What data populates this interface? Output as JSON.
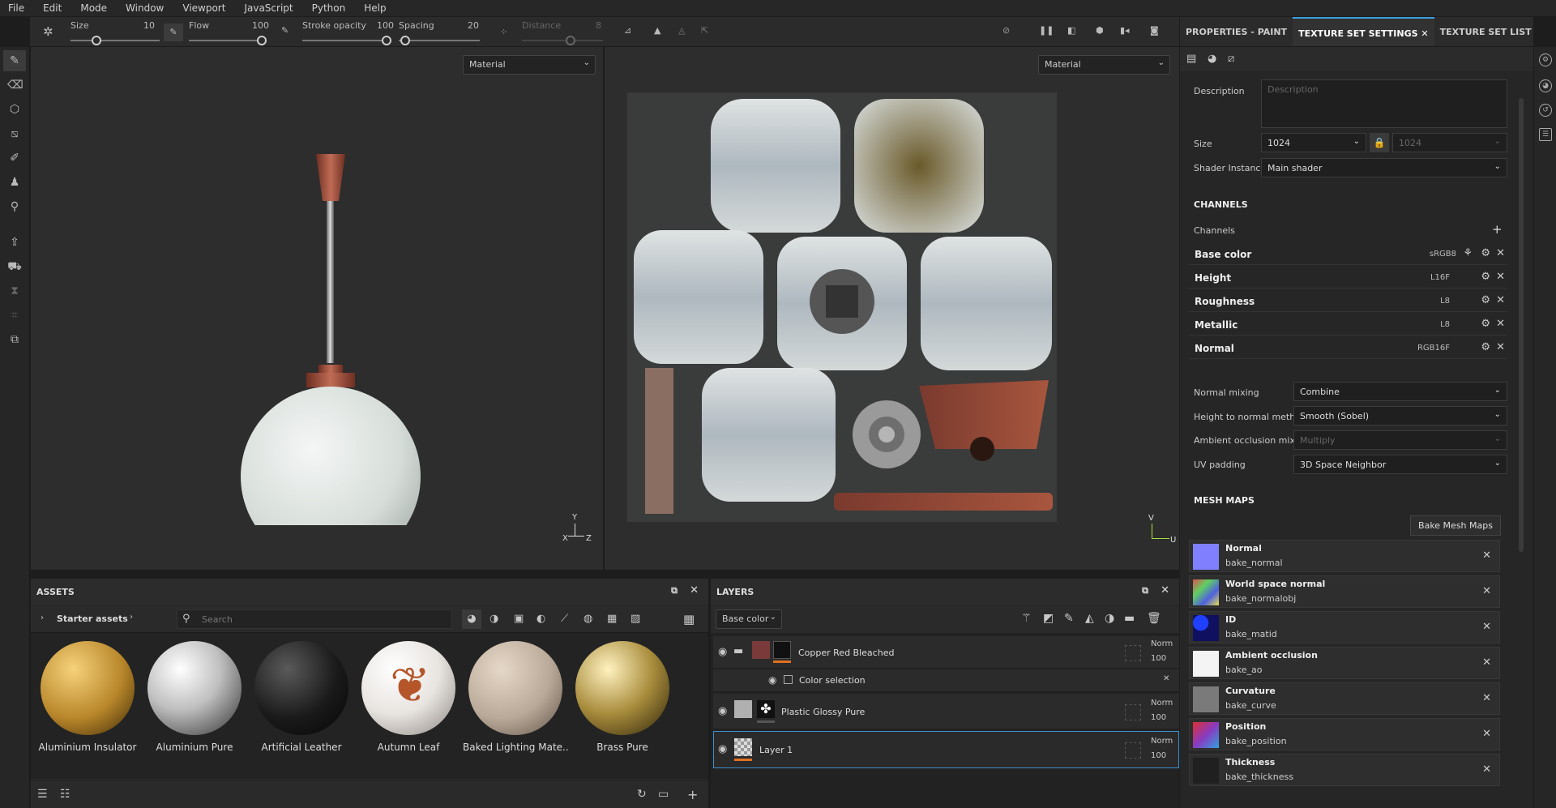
{
  "menu": [
    "File",
    "Edit",
    "Mode",
    "Window",
    "Viewport",
    "JavaScript",
    "Python",
    "Help"
  ],
  "toolbar": {
    "size_label": "Size",
    "size_value": "10",
    "flow_label": "Flow",
    "flow_value": "100",
    "stroke_label": "Stroke opacity",
    "stroke_value": "100",
    "spacing_label": "Spacing",
    "spacing_value": "20",
    "distance_label": "Distance",
    "distance_value": "8"
  },
  "viewport3d": {
    "mode": "Material",
    "axis_y": "Y",
    "axis_x": "X",
    "axis_z": "Z"
  },
  "viewport2d": {
    "mode": "Material",
    "axis_v": "V",
    "axis_u": "U"
  },
  "assets": {
    "title": "ASSETS",
    "breadcrumb": "Starter assets",
    "search_placeholder": "Search",
    "items": [
      {
        "label": "Aluminium Insulator",
        "color": "#b8862a"
      },
      {
        "label": "Aluminium Pure",
        "color": "#bfbfbf"
      },
      {
        "label": "Artificial Leather",
        "color": "#1a1a1a"
      },
      {
        "label": "Autumn Leaf",
        "color": "#e8e4e0"
      },
      {
        "label": "Baked Lighting Mate...",
        "color": "#b9a998"
      },
      {
        "label": "Brass Pure",
        "color": "#a88c3c"
      }
    ]
  },
  "layers": {
    "title": "LAYERS",
    "channel": "Base color",
    "rows": [
      {
        "name": "Copper Red Bleached",
        "blend": "Norm",
        "opacity": "100"
      },
      {
        "name": "Color selection"
      },
      {
        "name": "Plastic Glossy Pure",
        "blend": "Norm",
        "opacity": "100"
      },
      {
        "name": "Layer 1",
        "blend": "Norm",
        "opacity": "100"
      }
    ]
  },
  "rightpanel": {
    "tabs": [
      "PROPERTIES - PAINT",
      "TEXTURE SET SETTINGS",
      "TEXTURE SET LIST"
    ],
    "description_label": "Description",
    "description_placeholder": "Description",
    "size_label": "Size",
    "size_value": "1024",
    "size_value2": "1024",
    "shader_label": "Shader Instance",
    "shader_value": "Main shader",
    "channels_title": "CHANNELS",
    "channels_label": "Channels",
    "channels": [
      {
        "name": "Base color",
        "format": "sRGB8"
      },
      {
        "name": "Height",
        "format": "L16F"
      },
      {
        "name": "Roughness",
        "format": "L8"
      },
      {
        "name": "Metallic",
        "format": "L8"
      },
      {
        "name": "Normal",
        "format": "RGB16F"
      }
    ],
    "normal_mixing_label": "Normal mixing",
    "normal_mixing_value": "Combine",
    "h2n_label": "Height to normal method",
    "h2n_value": "Smooth (Sobel)",
    "ao_mixing_label": "Ambient occlusion mixing",
    "ao_mixing_value": "Multiply",
    "uv_label": "UV padding",
    "uv_value": "3D Space Neighbor",
    "mesh_title": "MESH MAPS",
    "bake_button": "Bake Mesh Maps",
    "mesh_maps": [
      {
        "name": "Normal",
        "file": "bake_normal",
        "color": "#8080ff"
      },
      {
        "name": "World space normal",
        "file": "bake_normalobj",
        "color": "#e06a9a"
      },
      {
        "name": "ID",
        "file": "bake_matid",
        "color": "#1f3ed8"
      },
      {
        "name": "Ambient occlusion",
        "file": "bake_ao",
        "color": "#f0f0f0"
      },
      {
        "name": "Curvature",
        "file": "bake_curve",
        "color": "#7a7a7a"
      },
      {
        "name": "Position",
        "file": "bake_position",
        "color": "#8a3ac0"
      },
      {
        "name": "Thickness",
        "file": "bake_thickness",
        "color": "#202020"
      }
    ]
  }
}
